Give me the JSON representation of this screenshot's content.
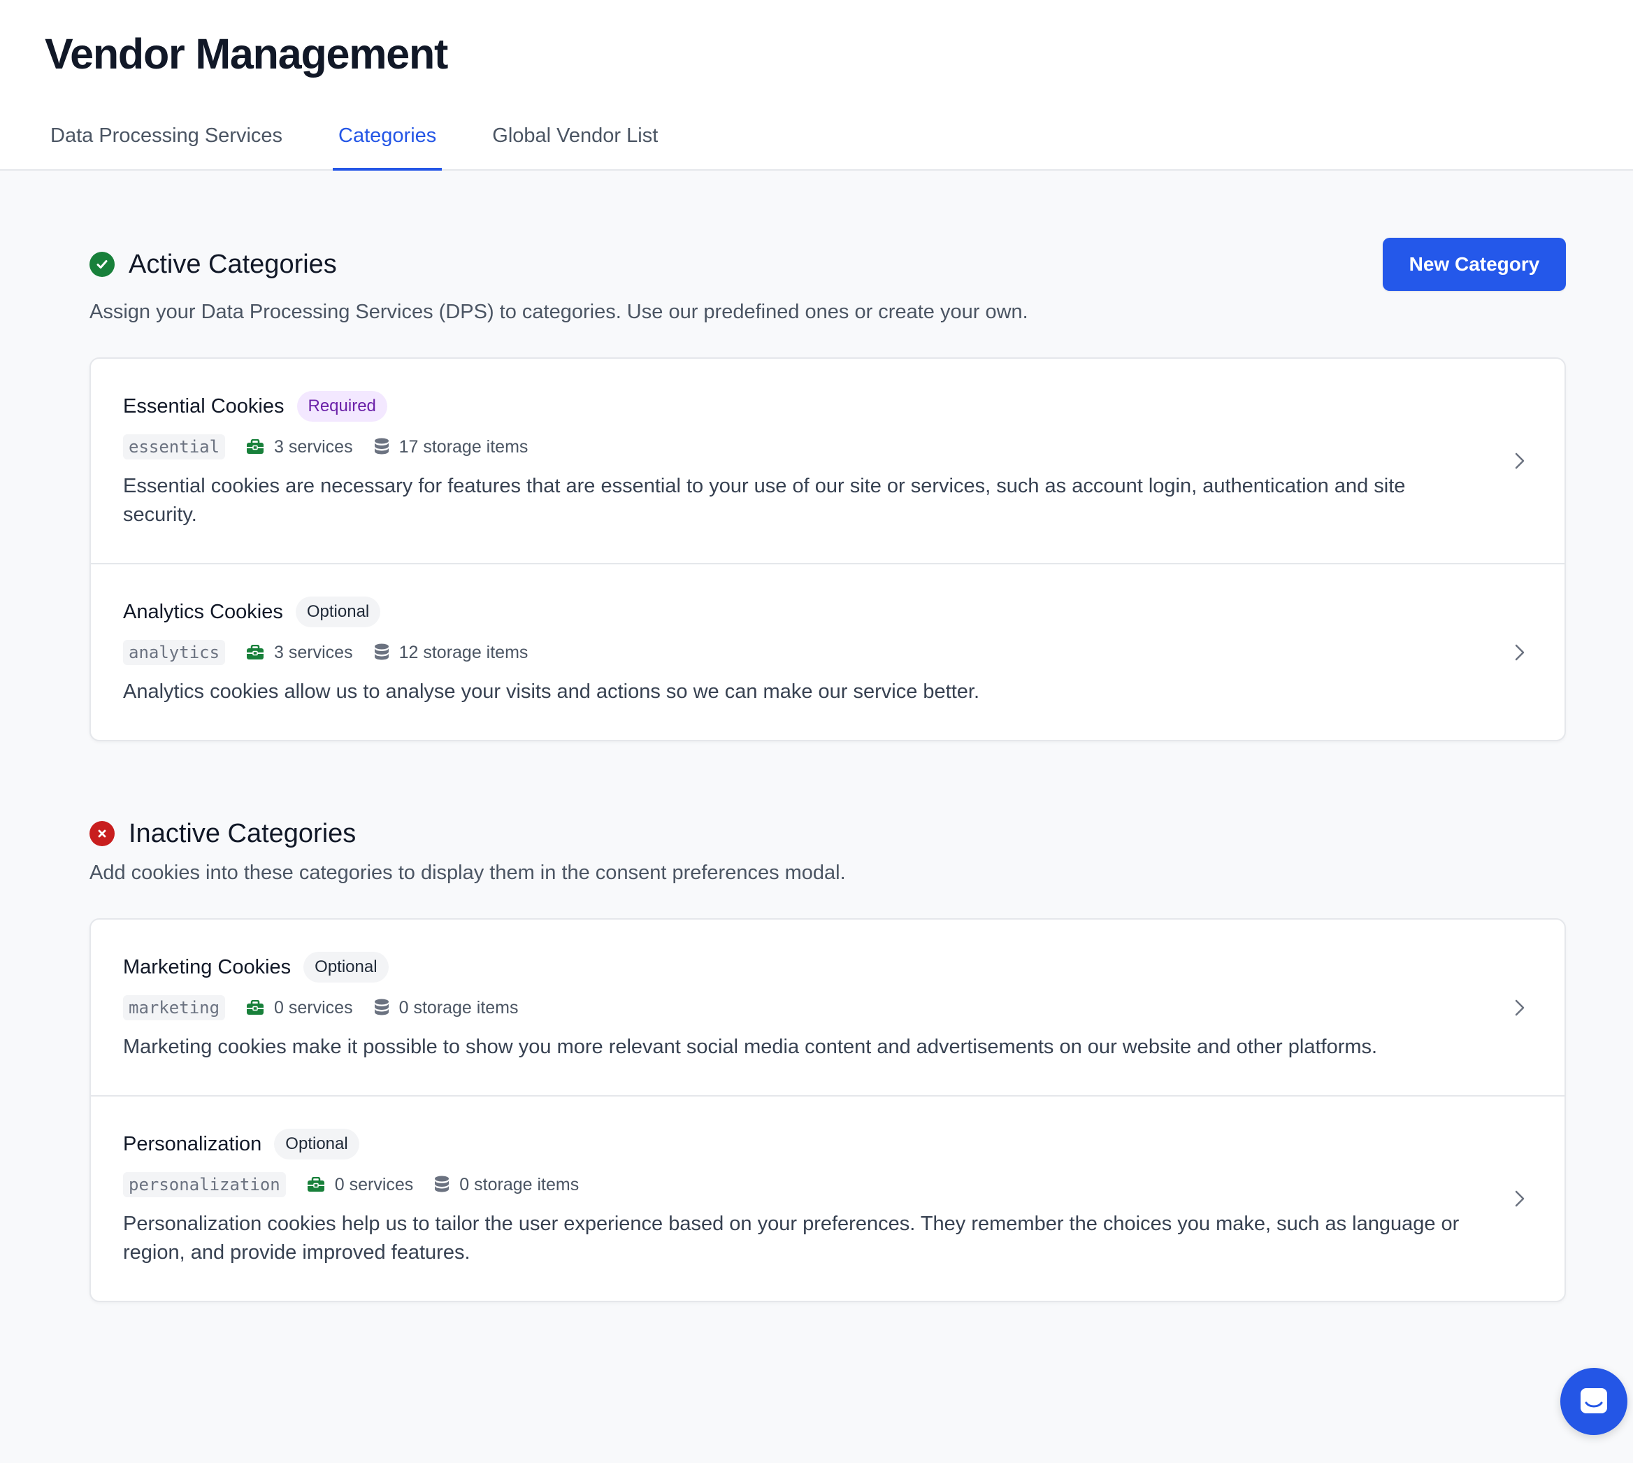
{
  "page_title": "Vendor Management",
  "tabs": [
    {
      "label": "Data Processing Services"
    },
    {
      "label": "Categories"
    },
    {
      "label": "Global Vendor List"
    }
  ],
  "active_tab": "Categories",
  "accent_color": "#2456e6",
  "active_section": {
    "title": "Active Categories",
    "description": "Assign your Data Processing Services (DPS) to categories. Use our predefined ones or create your own.",
    "new_button": "New Category",
    "icon": "check-circle-icon",
    "categories": [
      {
        "name": "Essential Cookies",
        "badge": "Required",
        "slug": "essential",
        "services": "3 services",
        "storage": "17 storage items",
        "description": "Essential cookies are necessary for features that are essential to your use of our site or services, such as account login, authentication and site security."
      },
      {
        "name": "Analytics Cookies",
        "badge": "Optional",
        "slug": "analytics",
        "services": "3 services",
        "storage": "12 storage items",
        "description": "Analytics cookies allow us to analyse your visits and actions so we can make our service better."
      }
    ]
  },
  "inactive_section": {
    "title": "Inactive Categories",
    "description": "Add cookies into these categories to display them in the consent preferences modal.",
    "icon": "x-circle-icon",
    "categories": [
      {
        "name": "Marketing Cookies",
        "badge": "Optional",
        "slug": "marketing",
        "services": "0 services",
        "storage": "0 storage items",
        "description": "Marketing cookies make it possible to show you more relevant social media content and advertisements on our website and other platforms."
      },
      {
        "name": "Personalization",
        "badge": "Optional",
        "slug": "personalization",
        "services": "0 services",
        "storage": "0 storage items",
        "description": "Personalization cookies help us to tailor the user experience based on your preferences. They remember the choices you make, such as language or region, and provide improved features."
      }
    ]
  }
}
